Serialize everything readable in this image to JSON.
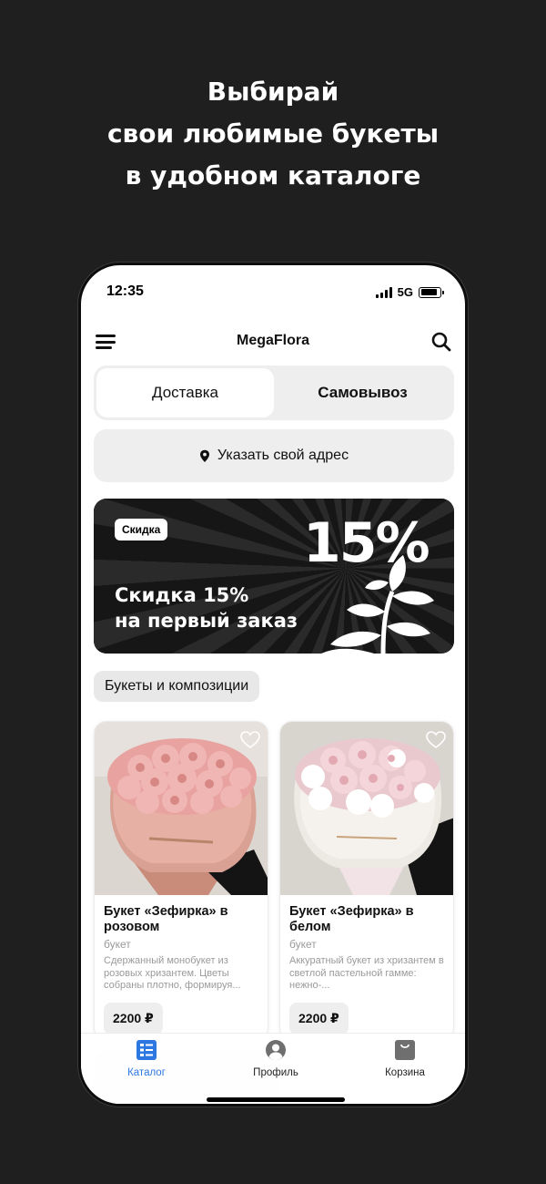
{
  "headline": {
    "line1": "Выбирай",
    "line2": "свои любимые букеты",
    "line3": "в удобном каталоге"
  },
  "status": {
    "time": "12:35",
    "network": "5G",
    "battery_level": 0.85
  },
  "app": {
    "title": "MegaFlora",
    "menu_icon": "hamburger-icon",
    "search_icon": "search-icon"
  },
  "delivery_mode": {
    "tabs": [
      "Доставка",
      "Самовывоз"
    ],
    "selected": "Доставка"
  },
  "address": {
    "label": "Указать свой адрес",
    "icon": "location-pin-icon"
  },
  "promo": {
    "badge": "Скидка",
    "percent": "15%",
    "line1": "Скидка 15%",
    "line2": "на первый заказ"
  },
  "category": {
    "label": "Букеты и композиции"
  },
  "products": [
    {
      "name": "Букет «Зефирка» в розовом",
      "type": "букет",
      "description": "Сдержанный монобукет из розовых хризантем. Цветы собраны плотно, формируя...",
      "price": "2200 ₽"
    },
    {
      "name": "Букет «Зефирка» в белом",
      "type": "букет",
      "description": "Аккуратный букет из хризантем в светлой пастельной гамме: нежно-...",
      "price": "2200 ₽"
    }
  ],
  "tabbar": {
    "items": [
      {
        "label": "Каталог",
        "icon": "catalog-icon"
      },
      {
        "label": "Профиль",
        "icon": "profile-icon"
      },
      {
        "label": "Корзина",
        "icon": "cart-bag-icon"
      }
    ],
    "active": "Каталог"
  },
  "colors": {
    "background": "#1f1f1f",
    "accent": "#2d77e0",
    "promo_bg": "#1a1a1a"
  }
}
